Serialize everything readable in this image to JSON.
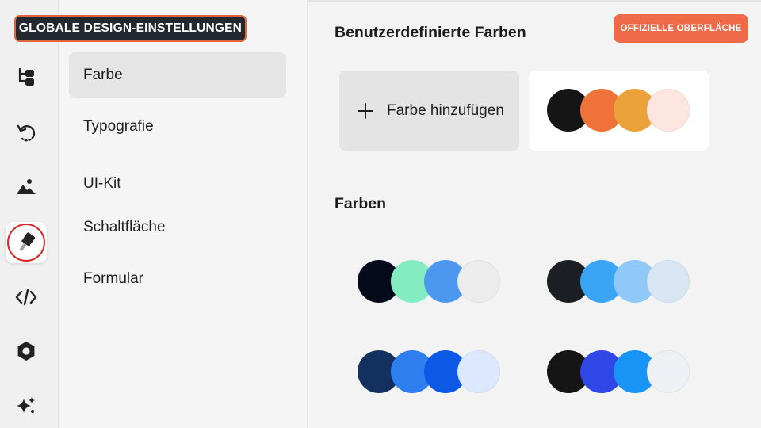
{
  "title_badge": "GLOBALE DESIGN-EINSTELLUNGEN",
  "rail": {
    "icons": [
      "hierarchy-icon",
      "history-icon",
      "image-icon",
      "brush-icon",
      "code-icon",
      "hexagon-icon",
      "sparkle-icon"
    ],
    "active": "brush-icon"
  },
  "nav": {
    "items": [
      {
        "label": "Farbe",
        "selected": true
      },
      {
        "label": "Typografie",
        "selected": false
      },
      {
        "label": "UI-Kit",
        "selected": false
      },
      {
        "label": "Schaltfläche",
        "selected": false
      },
      {
        "label": "Formular",
        "selected": false
      }
    ]
  },
  "main": {
    "custom_title": "Benutzerdefinierte Farben",
    "official_button": "OFFIZIELLE OBERFLÄCHE",
    "add_color_label": "Farbe hinzufügen",
    "custom_palette": [
      "#151515",
      "#ef7338",
      "#eba23a",
      "#fde6df"
    ],
    "colors_title": "Farben",
    "palettes": [
      [
        "#060b1c",
        "#83ecc0",
        "#4c97f0",
        "#ececec"
      ],
      [
        "#1c1f24",
        "#3aa4f5",
        "#90c8f8",
        "#d8e6f3"
      ],
      [
        "#14305e",
        "#2f7ef0",
        "#0b59e4",
        "#dbe8fd"
      ],
      [
        "#151515",
        "#2e47e6",
        "#1794f5",
        "#edf1f5"
      ]
    ]
  },
  "colors": {
    "accent": "#ef6a47",
    "badge_bg": "#23272e",
    "active_ring": "#d62a2a"
  }
}
